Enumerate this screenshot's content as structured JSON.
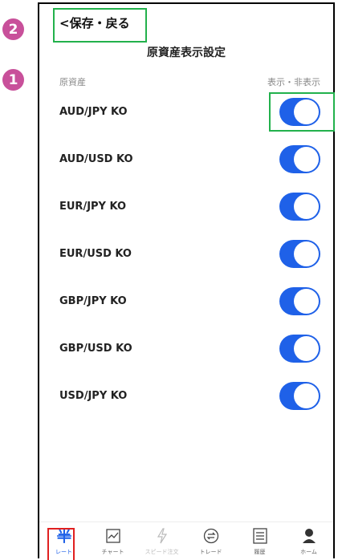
{
  "markers": {
    "first": "1",
    "second": "2"
  },
  "header": {
    "back_label": "<保存・戻る",
    "title": "原資産表示設定"
  },
  "columns": {
    "asset": "原資産",
    "visibility": "表示・非表示"
  },
  "assets": [
    {
      "label": "AUD/JPY KO",
      "visible": true
    },
    {
      "label": "AUD/USD KO",
      "visible": true
    },
    {
      "label": "EUR/JPY KO",
      "visible": true
    },
    {
      "label": "EUR/USD KO",
      "visible": true
    },
    {
      "label": "GBP/JPY KO",
      "visible": true
    },
    {
      "label": "GBP/USD KO",
      "visible": true
    },
    {
      "label": "USD/JPY KO",
      "visible": true
    }
  ],
  "tabbar": {
    "tabs": [
      {
        "label": "レート",
        "icon": "rate-icon",
        "state": "active"
      },
      {
        "label": "チャート",
        "icon": "chart-icon",
        "state": "normal"
      },
      {
        "label": "スピード注文",
        "icon": "lightning-icon",
        "state": "disabled"
      },
      {
        "label": "トレード",
        "icon": "trade-icon",
        "state": "normal"
      },
      {
        "label": "履歴",
        "icon": "history-icon",
        "state": "normal"
      },
      {
        "label": "ホーム",
        "icon": "person-icon",
        "state": "normal"
      }
    ]
  },
  "colors": {
    "toggle_on": "#1f61e8",
    "annotation_green": "#22b14c",
    "annotation_red": "#e02020",
    "marker": "#c8509a"
  }
}
